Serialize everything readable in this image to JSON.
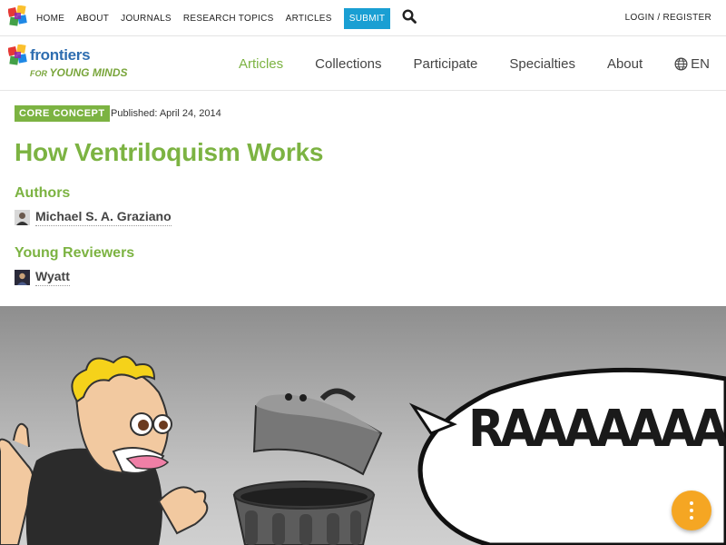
{
  "topbar": {
    "items": [
      "HOME",
      "ABOUT",
      "JOURNALS",
      "RESEARCH TOPICS",
      "ARTICLES"
    ],
    "submit_label": "SUBMIT",
    "login_label": "LOGIN / REGISTER",
    "search_icon": "search-icon",
    "submit_color": "#1a9fd3"
  },
  "brand": {
    "name": "frontiers",
    "sub_prefix": "FOR ",
    "sub": "YOUNG MINDS"
  },
  "mainnav": {
    "items": [
      "Articles",
      "Collections",
      "Participate",
      "Specialties",
      "About"
    ],
    "active": "Articles",
    "lang_label": "EN",
    "lang_icon": "globe-icon"
  },
  "article": {
    "badge": "CORE CONCEPT",
    "published": "Published: April 24, 2014",
    "title": "How Ventriloquism Works",
    "authors_heading": "Authors",
    "author_name": "Michael S. A. Graziano",
    "reviewers_heading": "Young Reviewers",
    "reviewer_name": "Wyatt",
    "accent_color": "#7cb342"
  },
  "hero": {
    "speech_text": "RAAAAAAAA"
  },
  "fab": {
    "icon": "more-vertical-icon",
    "color": "#f5a623"
  }
}
